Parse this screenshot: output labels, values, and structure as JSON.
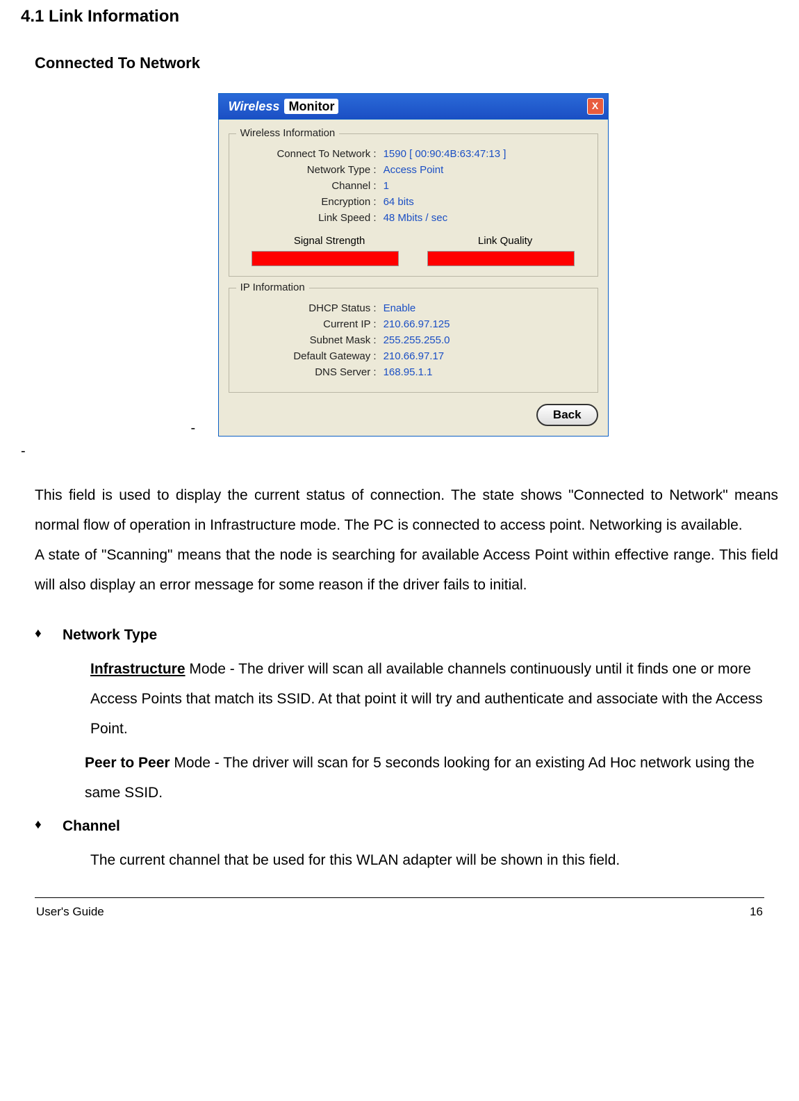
{
  "section_title": "4.1 Link Information",
  "subtitle": "Connected To Network",
  "window": {
    "brand_part1": "Wireless",
    "brand_part2": "Monitor",
    "close": "X",
    "wireless": {
      "legend": "Wireless Information",
      "connect_label": "Connect To Network :",
      "connect_value": "1590 [ 00:90:4B:63:47:13 ]",
      "nettype_label": "Network Type :",
      "nettype_value": "Access Point",
      "channel_label": "Channel :",
      "channel_value": "1",
      "enc_label": "Encryption :",
      "enc_value": "64 bits",
      "speed_label": "Link Speed :",
      "speed_value": "48 Mbits / sec",
      "sig_strength": "Signal Strength",
      "link_quality": "Link Quality"
    },
    "ip": {
      "legend": "IP Information",
      "dhcp_label": "DHCP Status :",
      "dhcp_value": "Enable",
      "ip_label": "Current IP :",
      "ip_value": "210.66.97.125",
      "mask_label": "Subnet Mask :",
      "mask_value": "255.255.255.0",
      "gw_label": "Default Gateway :",
      "gw_value": "210.66.97.17",
      "dns_label": "DNS Server :",
      "dns_value": "168.95.1.1"
    },
    "back": "Back"
  },
  "para1": "This field is used to display the current status of connection. The state shows \"Connected to Network\" means normal flow of operation in Infrastructure mode. The PC is connected to access point.  Networking is available.",
  "para2": "A state of \"Scanning\" means that the node is searching for available Access Point within effective range. This field will also display an error message for some reason if the driver fails to initial.",
  "bullets": {
    "net_type": "Network Type",
    "infra_bold": "Infrastructure",
    "infra_rest": " Mode   - The driver will scan all available channels continuously until it finds one or more Access Points that match its SSID.  At that point it will try and authenticate and associate with the Access Point.",
    "p2p_bold": "Peer to Peer",
    "p2p_rest": " Mode  - The driver will scan for 5 seconds looking for an existing Ad Hoc network using the same SSID.",
    "channel": "Channel",
    "channel_body": "The current channel that be used for this WLAN adapter will be shown in this field."
  },
  "footer": {
    "left": "User's Guide",
    "right": "16"
  }
}
